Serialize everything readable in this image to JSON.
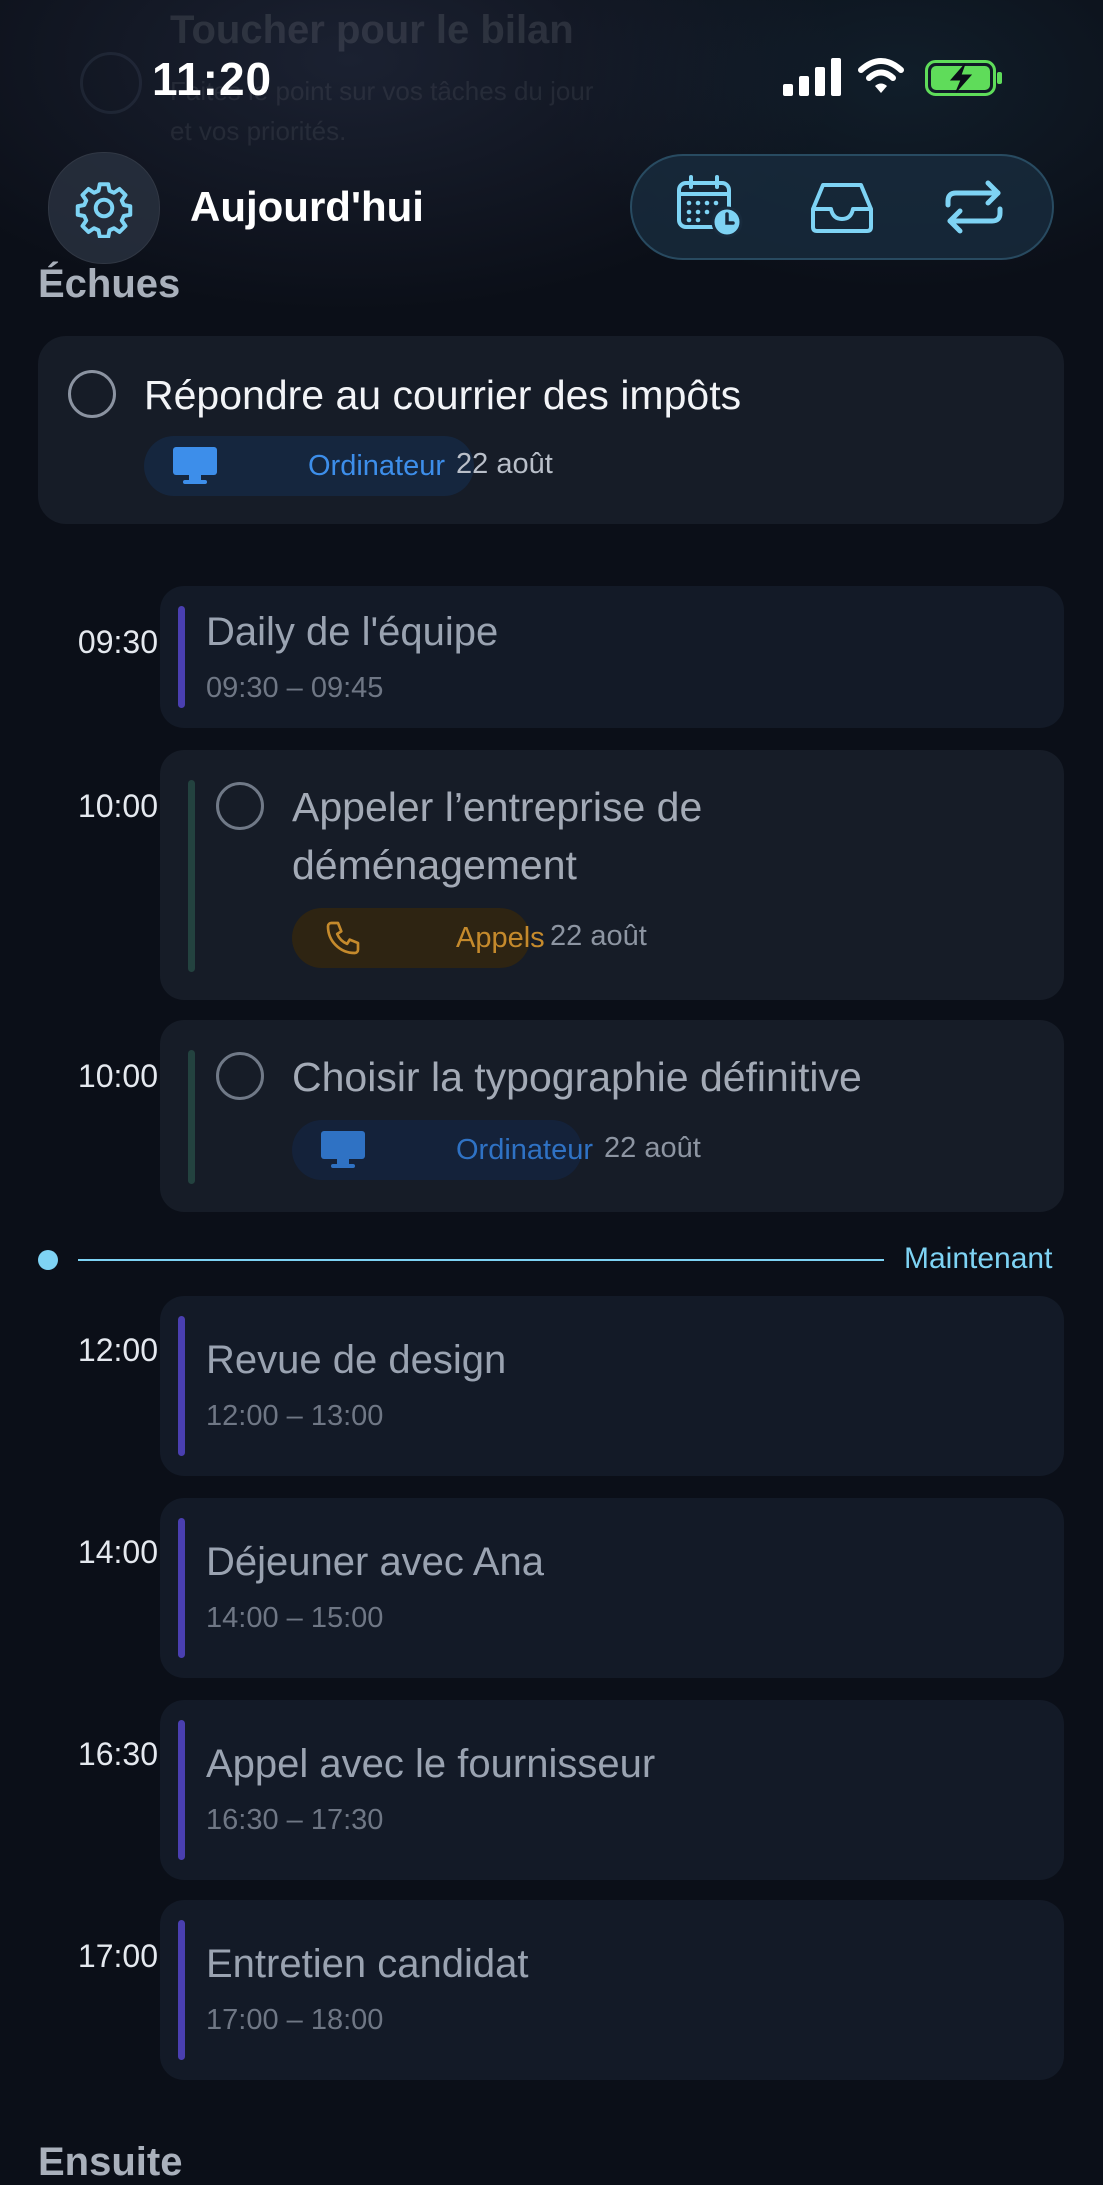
{
  "status_bar": {
    "time": "11:20"
  },
  "background_banner": {
    "title": "Toucher pour le bilan",
    "subtitle_line1": "Faites le point sur vos tâches du jour",
    "subtitle_line2": "et vos priorités."
  },
  "header": {
    "title": "Aujourd'hui"
  },
  "overdue": {
    "section_title": "Échues",
    "tasks": [
      {
        "title": "Répondre au courrier des impôts",
        "tag": "Ordinateur",
        "tag_icon": "computer-icon",
        "date": "22 août"
      }
    ]
  },
  "timeline": {
    "now_label": "Maintenant",
    "items": [
      {
        "kind": "event",
        "time": "09:30",
        "title": "Daily de l'équipe",
        "range": "09:30 – 09:45"
      },
      {
        "kind": "task",
        "time": "10:00",
        "title_line1": "Appeler l’entreprise de",
        "title_line2": "déménagement",
        "tag": "Appels",
        "tag_icon": "phone-icon",
        "date": "22 août"
      },
      {
        "kind": "task",
        "time": "10:00",
        "title_line1": "Choisir la typographie définitive",
        "tag": "Ordinateur",
        "tag_icon": "computer-icon",
        "date": "22 août"
      },
      {
        "kind": "event",
        "time": "12:00",
        "title": "Revue de design",
        "range": "12:00 – 13:00"
      },
      {
        "kind": "event",
        "time": "14:00",
        "title": "Déjeuner avec Ana",
        "range": "14:00 – 15:00"
      },
      {
        "kind": "event",
        "time": "16:30",
        "title": "Appel avec le fournisseur",
        "range": "16:30 – 17:30"
      },
      {
        "kind": "event",
        "time": "17:00",
        "title": "Entretien candidat",
        "range": "17:00 – 18:00"
      }
    ]
  },
  "next_section": {
    "title": "Ensuite"
  },
  "colors": {
    "accent": "#7ed3f4",
    "event_bar": "#4a3fb0",
    "tag_computer": "#3d8eea",
    "tag_calls": "#c58a2c",
    "battery_green": "#5fdc5a"
  }
}
